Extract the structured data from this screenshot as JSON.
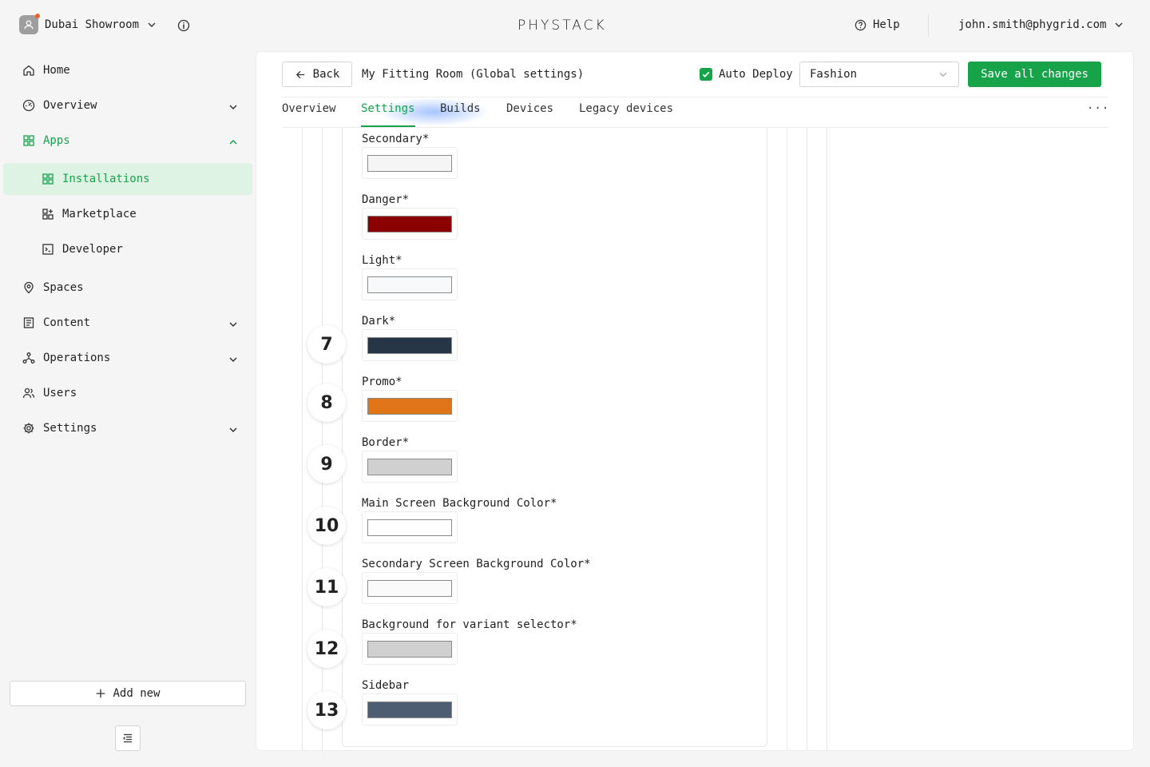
{
  "topbar": {
    "org_name": "Dubai Showroom",
    "logo_text": "PHYSTACK",
    "help_label": "Help",
    "user_email": "john.smith@phygrid.com"
  },
  "sidebar": {
    "items": [
      {
        "label": "Home",
        "icon": "home-icon"
      },
      {
        "label": "Overview",
        "icon": "dashboard-icon"
      },
      {
        "label": "Apps",
        "icon": "apps-icon"
      },
      {
        "label": "Installations",
        "icon": "grid-icon"
      },
      {
        "label": "Marketplace",
        "icon": "marketplace-icon"
      },
      {
        "label": "Developer",
        "icon": "terminal-icon"
      },
      {
        "label": "Spaces",
        "icon": "location-pin-icon"
      },
      {
        "label": "Content",
        "icon": "document-icon"
      },
      {
        "label": "Operations",
        "icon": "network-icon"
      },
      {
        "label": "Users",
        "icon": "users-icon"
      },
      {
        "label": "Settings",
        "icon": "gear-icon"
      }
    ],
    "add_new_label": "Add new"
  },
  "header": {
    "back_label": "Back",
    "title": "My Fitting Room (Global settings)",
    "auto_deploy_label": "Auto Deploy",
    "auto_deploy_checked": true,
    "select_value": "Fashion",
    "save_label": "Save all changes"
  },
  "tabs": [
    {
      "label": "Overview"
    },
    {
      "label": "Settings",
      "active": true
    },
    {
      "label": "Builds"
    },
    {
      "label": "Devices"
    },
    {
      "label": "Legacy devices"
    }
  ],
  "colors": {
    "accent": "#16a34a",
    "accent_light": "#dff3e4"
  },
  "fields": [
    {
      "label": "Secondary*",
      "color": "#f5f5f5",
      "step": ""
    },
    {
      "label": "Danger*",
      "color": "#8b0000",
      "step": ""
    },
    {
      "label": "Light*",
      "color": "#f8f9fa",
      "step": ""
    },
    {
      "label": "Dark*",
      "color": "#263646",
      "step": "7"
    },
    {
      "label": "Promo*",
      "color": "#e07418",
      "step": "8"
    },
    {
      "label": "Border*",
      "color": "#d0d0d0",
      "step": "9"
    },
    {
      "label": "Main Screen Background Color*",
      "color": "#ffffff",
      "step": "10"
    },
    {
      "label": "Secondary Screen Background Color*",
      "color": "#fafafa",
      "step": "11"
    },
    {
      "label": "Background for variant selector*",
      "color": "#d0d0d0",
      "step": "12"
    },
    {
      "label": "Sidebar",
      "color": "#4d5e73",
      "step": "13"
    }
  ]
}
